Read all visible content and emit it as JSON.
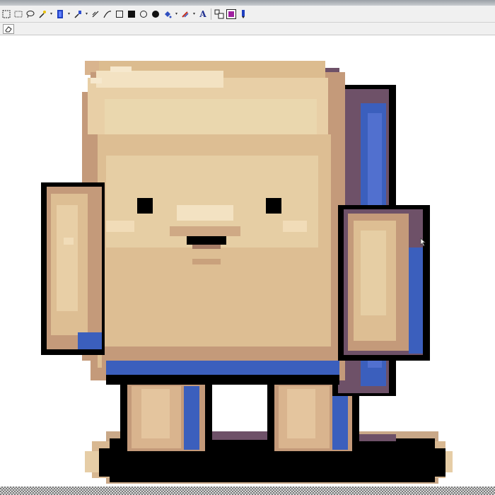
{
  "toolbar": {
    "tools": [
      {
        "name": "rect-select-icon"
      },
      {
        "name": "freeform-select-icon"
      },
      {
        "name": "lasso-icon"
      },
      {
        "name": "magic-wand-icon",
        "dropdown": true
      },
      {
        "name": "move-selection-icon",
        "dropdown": true
      },
      {
        "name": "eyedropper-icon",
        "dropdown": true
      },
      {
        "name": "line-tool-icon"
      },
      {
        "name": "curve-tool-icon"
      },
      {
        "name": "rectangle-outline-icon"
      },
      {
        "name": "rectangle-filled-icon"
      },
      {
        "name": "ellipse-outline-icon"
      },
      {
        "name": "ellipse-filled-icon"
      },
      {
        "name": "fill-bucket-icon",
        "dropdown": true
      },
      {
        "name": "brush-icon",
        "dropdown": true
      },
      {
        "name": "text-tool-icon",
        "label": "A"
      },
      {
        "name": "zoom-tool-icon"
      },
      {
        "name": "color-swatch-icon"
      },
      {
        "name": "pencil-icon"
      }
    ]
  },
  "toolbar2": {
    "tools": [
      {
        "name": "eraser-icon"
      }
    ]
  },
  "canvas": {
    "subject": "pixel-art-toast-character",
    "colors": {
      "outline": "#000000",
      "bread_light": "#ead7ae",
      "bread_mid": "#dcbc8f",
      "bread_dark": "#c49a7a",
      "crust_shadow": "#6e5168",
      "blue_shade": "#3b5fbd",
      "shadow": "#000000"
    }
  }
}
